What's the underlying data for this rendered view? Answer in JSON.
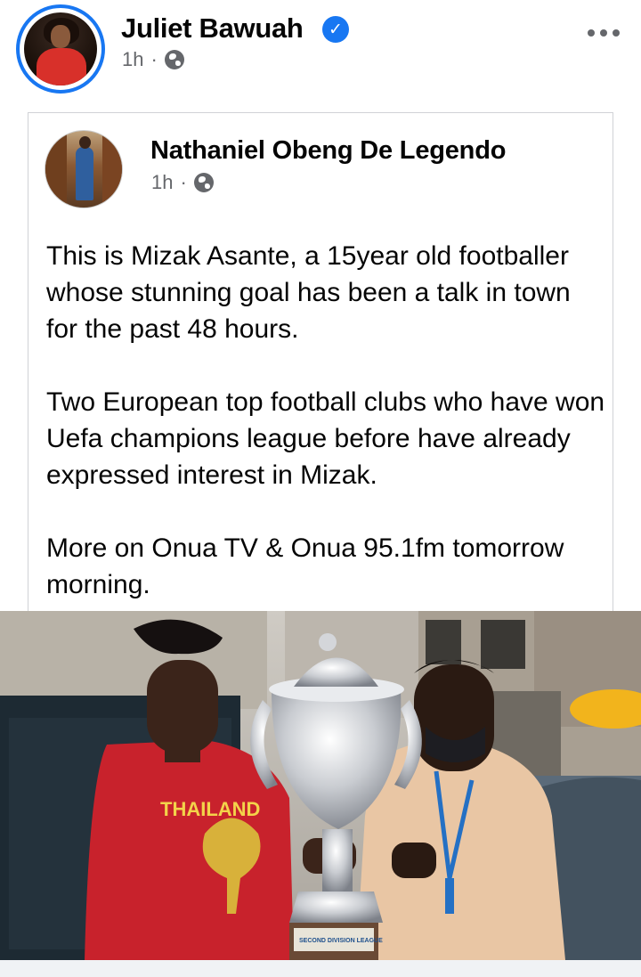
{
  "post": {
    "author": "Juliet Bawuah",
    "time": "1h",
    "separator": "·",
    "icons": {
      "avatar": "profile-photo",
      "verified": "verified-badge-icon",
      "audience": "globe-icon",
      "more": "more-options-icon"
    }
  },
  "shared_post": {
    "author": "Nathaniel Obeng De Legendo",
    "time": "1h",
    "separator": "·",
    "paragraphs": [
      "This is Mizak Asante, a 15year old footballer whose stunning goal has been a talk in town for the past 48 hours.",
      "Two European top football clubs who have won Uefa champions league before have already expressed interest in Mizak.",
      "More on Onua TV & Onua 95.1fm tomorrow morning."
    ]
  },
  "photo": {
    "shirt_text": "THAILAND",
    "trophy_plaque": "SECOND DIVISION LEAGUE"
  },
  "colors": {
    "accent": "#1877f2",
    "meta": "#65676b",
    "border": "#d0d2d6"
  }
}
